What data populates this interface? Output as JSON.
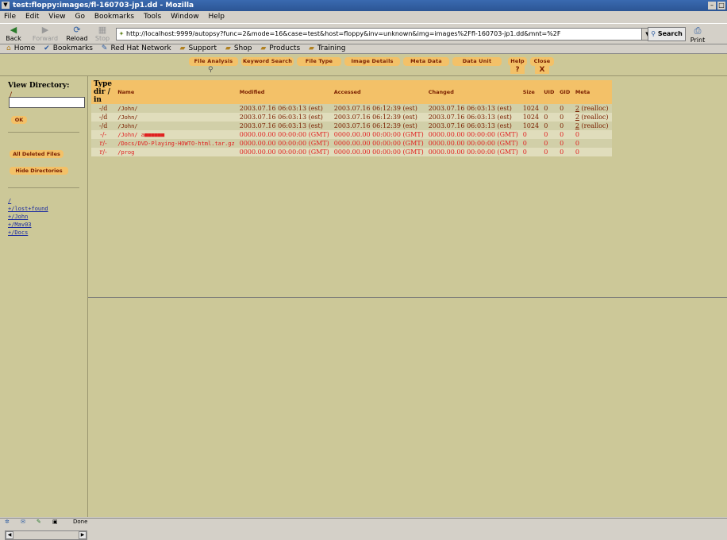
{
  "window": {
    "title": "test:floppy:images/fl-160703-jp1.dd - Mozilla"
  },
  "menu": [
    "File",
    "Edit",
    "View",
    "Go",
    "Bookmarks",
    "Tools",
    "Window",
    "Help"
  ],
  "nav": {
    "back": "Back",
    "forward": "Forward",
    "reload": "Reload",
    "stop": "Stop",
    "print": "Print",
    "search": "Search"
  },
  "url": "http://localhost:9999/autopsy?func=2&mode=16&case=test&host=floppy&inv=unknown&img=images%2Ffl-160703-jp1.dd&mnt=%2F",
  "personal": [
    "Home",
    "Bookmarks",
    "Red Hat Network",
    "Support",
    "Shop",
    "Products",
    "Training"
  ],
  "tabs": [
    "File Analysis",
    "Keyword Search",
    "File Type",
    "Image Details",
    "Meta Data",
    "Data Unit",
    "Help",
    "Close"
  ],
  "tab_help_icon": "?",
  "tab_close_icon": "X",
  "left": {
    "title": "View Directory:",
    "root": "/",
    "ok": "OK",
    "all_deleted": "All Deleted Files",
    "hide_dirs": "Hide Directories",
    "tree_root": "/",
    "tree": [
      "+/lost+found",
      "+/John",
      "+/Mav03",
      "+/Docs"
    ]
  },
  "table": {
    "headers": {
      "type": "Type dir / in",
      "name": "Name",
      "modified": "Modified",
      "accessed": "Accessed",
      "changed": "Changed",
      "size": "Size",
      "uid": "UID",
      "gid": "GID",
      "meta": "Meta"
    },
    "rows": [
      {
        "type": "-/d",
        "name": "/John/",
        "modified": "2003.07.16 06:03:13 (est)",
        "accessed": "2003.07.16 06:12:39 (est)",
        "changed": "2003.07.16 06:03:13 (est)",
        "size": "1024",
        "uid": "0",
        "gid": "0",
        "meta": "2",
        "meta_note": "(realloc)"
      },
      {
        "type": "-/d",
        "name": "/John/",
        "modified": "2003.07.16 06:03:13 (est)",
        "accessed": "2003.07.16 06:12:39 (est)",
        "changed": "2003.07.16 06:03:13 (est)",
        "size": "1024",
        "uid": "0",
        "gid": "0",
        "meta": "2",
        "meta_note": "(realloc)"
      },
      {
        "type": "-/d",
        "name": "/John/",
        "modified": "2003.07.16 06:03:13 (est)",
        "accessed": "2003.07.16 06:12:39 (est)",
        "changed": "2003.07.16 06:03:13 (est)",
        "size": "1024",
        "uid": "0",
        "gid": "0",
        "meta": "2",
        "meta_note": "(realloc)"
      },
      {
        "type": "-/-",
        "name": "/John/ a■■■■■■",
        "modified": "0000.00.00 00:00:00 (GMT)",
        "accessed": "0000.00.00 00:00:00 (GMT)",
        "changed": "0000.00.00 00:00:00 (GMT)",
        "size": "0",
        "uid": "0",
        "gid": "0",
        "meta": "0",
        "meta_note": ""
      },
      {
        "type": "r/-",
        "name": "/Docs/DVD-Playing-HOWTO-html.tar.gz",
        "modified": "0000.00.00 00:00:00 (GMT)",
        "accessed": "0000.00.00 00:00:00 (GMT)",
        "changed": "0000.00.00 00:00:00 (GMT)",
        "size": "0",
        "uid": "0",
        "gid": "0",
        "meta": "0",
        "meta_note": ""
      },
      {
        "type": "r/-",
        "name": "/prog",
        "modified": "0000.00.00 00:00:00 (GMT)",
        "accessed": "0000.00.00 00:00:00 (GMT)",
        "changed": "0000.00.00 00:00:00 (GMT)",
        "size": "0",
        "uid": "0",
        "gid": "0",
        "meta": "0",
        "meta_note": ""
      }
    ]
  },
  "status": {
    "text": "Done"
  },
  "colors": {
    "panel": "#ccc898",
    "tab": "#f3c168",
    "alloc_text": "#7a2000",
    "deleted_text": "#e02020"
  }
}
